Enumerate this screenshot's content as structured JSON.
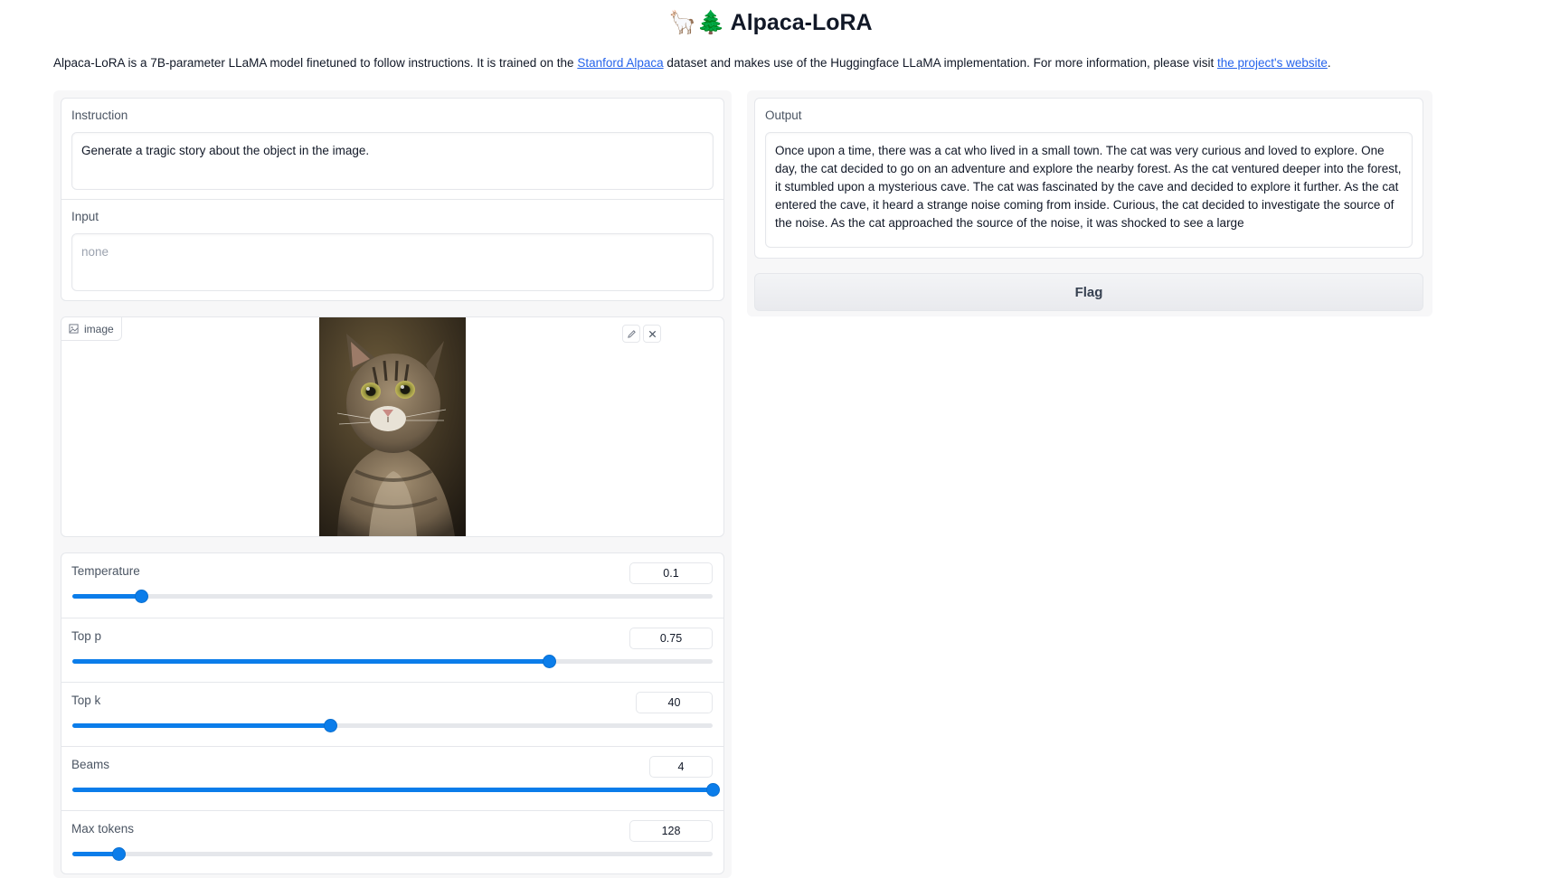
{
  "header": {
    "title_emoji": "🦙🌲",
    "title": "Alpaca-LoRA",
    "description_prefix": "Alpaca-LoRA is a 7B-parameter LLaMA model finetuned to follow instructions. It is trained on the ",
    "link_stanford": "Stanford Alpaca",
    "description_middle": " dataset and makes use of the Huggingface LLaMA implementation. For more information, please visit ",
    "link_project": "the project's website",
    "description_suffix": "."
  },
  "inputs": {
    "instruction": {
      "label": "Instruction",
      "value": "Generate a tragic story about the object in the image."
    },
    "input": {
      "label": "Input",
      "placeholder": "none"
    },
    "image": {
      "label": "image"
    }
  },
  "sliders": [
    {
      "label": "Temperature",
      "value": "0.1",
      "fraction": 0.108
    },
    {
      "label": "Top p",
      "value": "0.75",
      "fraction": 0.745
    },
    {
      "label": "Top k",
      "value": "40",
      "fraction": 0.402
    },
    {
      "label": "Beams",
      "value": "4",
      "fraction": 1.0
    },
    {
      "label": "Max tokens",
      "value": "128",
      "fraction": 0.072
    }
  ],
  "output": {
    "label": "Output",
    "text": "Once upon a time, there was a cat who lived in a small town. The cat was very curious and loved to explore. One day, the cat decided to go on an adventure and explore the nearby forest. As the cat ventured deeper into the forest, it stumbled upon a mysterious cave. The cat was fascinated by the cave and decided to explore it further. As the cat entered the cave, it heard a strange noise coming from inside. Curious, the cat decided to investigate the source of the noise. As the cat approached the source of the noise, it was shocked to see a large"
  },
  "flag_button": "Flag",
  "colors": {
    "accent": "#0b7dea",
    "link": "#2563eb",
    "panel_bg": "#f7f7f8",
    "border": "#e5e7eb"
  }
}
